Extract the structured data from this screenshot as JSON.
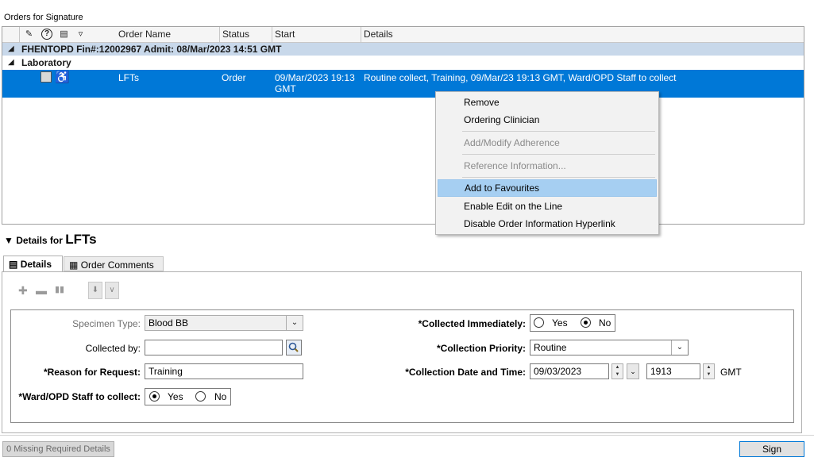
{
  "title": "Orders for Signature",
  "grid": {
    "header_icons": [
      "pin-icon",
      "help-icon",
      "edit-icon",
      "filter-icon"
    ],
    "columns": [
      "Order Name",
      "Status",
      "Start",
      "Details"
    ],
    "group": "FHENTOPD  Fin#:12002967  Admit: 08/Mar/2023 14:51 GMT",
    "category": "Laboratory",
    "row": {
      "name": "LFTs",
      "status": "Order",
      "start_line1": "09/Mar/2023 19:13",
      "start_line2": "GMT",
      "details": "Routine collect, Training, 09/Mar/23 19:13 GMT, Ward/OPD Staff to collect"
    }
  },
  "context_menu": {
    "items": [
      {
        "label": "Remove",
        "state": "enabled"
      },
      {
        "label": "Ordering Clinician",
        "state": "enabled"
      },
      {
        "label": "Add/Modify Adherence",
        "state": "disabled"
      },
      {
        "label": "Reference Information...",
        "state": "disabled"
      },
      {
        "label": "Add to Favourites",
        "state": "highlighted"
      },
      {
        "label": "Enable Edit on the Line",
        "state": "enabled"
      },
      {
        "label": "Disable Order Information Hyperlink",
        "state": "enabled"
      }
    ]
  },
  "details": {
    "heading_prefix": "Details for",
    "heading_name": "LFTs",
    "tabs": [
      "Details",
      "Order Comments"
    ]
  },
  "form": {
    "specimen_type": {
      "label": "Specimen Type:",
      "value": "Blood BB"
    },
    "collected_by": {
      "label": "Collected by:",
      "value": ""
    },
    "reason": {
      "label": "*Reason for Request:",
      "value": "Training"
    },
    "ward_staff": {
      "label": "*Ward/OPD Staff to collect:",
      "yes": "Yes",
      "no": "No",
      "selected": "Yes"
    },
    "collected_immediately": {
      "label": "*Collected Immediately:",
      "yes": "Yes",
      "no": "No",
      "selected": "No"
    },
    "collection_priority": {
      "label": "*Collection Priority:",
      "value": "Routine"
    },
    "collection_datetime": {
      "label": "*Collection Date and Time:",
      "date": "09/03/2023",
      "time": "1913",
      "tz": "GMT"
    }
  },
  "footer": {
    "missing": "0 Missing Required Details",
    "sign": "Sign"
  },
  "colors": {
    "selection": "#0078d7",
    "group_row": "#c8d8ea",
    "menu_highlight": "#a6cff2"
  }
}
